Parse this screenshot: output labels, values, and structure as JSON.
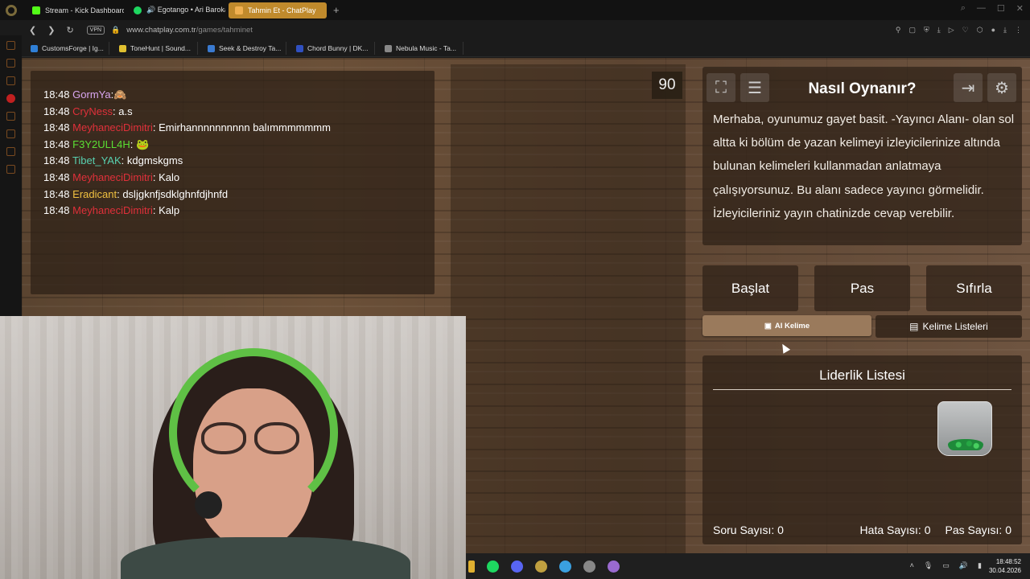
{
  "browser": {
    "tabs": [
      {
        "label": "Stream - Kick Dashboard",
        "color": "#53fc18"
      },
      {
        "label": "🔊 Egotango • Ari Barokas",
        "color": "#1ed760"
      },
      {
        "label": "Tahmin Et - ChatPlay",
        "color": "#c08a2c"
      }
    ],
    "new_tab": "+",
    "vpn": "VPN",
    "url_host": "www.chatplay.com.tr",
    "url_path": "/games/tahminet",
    "bookmarks": [
      {
        "label": "CustomsForge | Ig...",
        "color": "#2f7fd6"
      },
      {
        "label": "ToneHunt | Sound...",
        "color": "#e0c030"
      },
      {
        "label": "Seek & Destroy Ta...",
        "color": "#3a7ad0"
      },
      {
        "label": "Chord Bunny | DK...",
        "color": "#3050c0"
      },
      {
        "label": "Nebula Music - Ta...",
        "color": "#888888"
      }
    ]
  },
  "chat": {
    "messages": [
      {
        "time": "18:48",
        "user": "GormYa",
        "color": "#d9a6f0",
        "text": "🙈"
      },
      {
        "time": "18:48",
        "user": "CryNess",
        "color": "#e0303a",
        "text": " a.s"
      },
      {
        "time": "18:48",
        "user": "MeyhaneciDimitri",
        "color": "#e0303a",
        "text": " Emirhannnnnnnnnn balımmmmmmm"
      },
      {
        "time": "18:48",
        "user": "F3Y2ULL4H",
        "color": "#5be034",
        "text": " 🐸"
      },
      {
        "time": "18:48",
        "user": "Tibet_YAK",
        "color": "#58d0b0",
        "text": " kdgmskgms"
      },
      {
        "time": "18:48",
        "user": "MeyhaneciDimitri",
        "color": "#e0303a",
        "text": " Kalo"
      },
      {
        "time": "18:48",
        "user": "Eradicant",
        "color": "#f0c040",
        "text": " dsljgknfjsdklghnfdjhnfd"
      },
      {
        "time": "18:48",
        "user": "MeyhaneciDimitri",
        "color": "#e0303a",
        "text": " Kalp"
      }
    ]
  },
  "game": {
    "timer": "90",
    "howto_title": "Nasıl Oynanır?",
    "howto_text": "Merhaba, oyunumuz gayet basit. -Yayıncı Alanı- olan sol altta ki bölüm de yazan kelimeyi izleyicilerinize altında bulunan kelimeleri kullanmadan anlatmaya çalışıyorsunuz. Bu alanı sadece yayıncı görmelidir. İzleyicileriniz yayın chatinizde cevap verebilir.",
    "buttons": {
      "start": "Başlat",
      "pass": "Pas",
      "reset": "Sıfırla"
    },
    "ai_word": "AI Kelime",
    "word_lists": "Kelime Listeleri",
    "leaderboard_title": "Liderlik Listesi",
    "stats": {
      "questions_label": "Soru Sayısı:",
      "questions": "0",
      "errors_label": "Hata Sayısı:",
      "errors": "0",
      "passes_label": "Pas Sayısı:",
      "passes": "0"
    }
  },
  "taskbar": {
    "icons": [
      {
        "name": "spotify-icon",
        "color": "#1ed760"
      },
      {
        "name": "discord-icon",
        "color": "#5865f2"
      },
      {
        "name": "opera-icon",
        "color": "#c0a040"
      },
      {
        "name": "app-icon",
        "color": "#3aa0e0"
      },
      {
        "name": "obs-icon",
        "color": "#888888"
      },
      {
        "name": "stream-app-icon",
        "color": "#9a6ad0"
      }
    ],
    "time": "18:48:52",
    "date": "30.04.2026"
  }
}
